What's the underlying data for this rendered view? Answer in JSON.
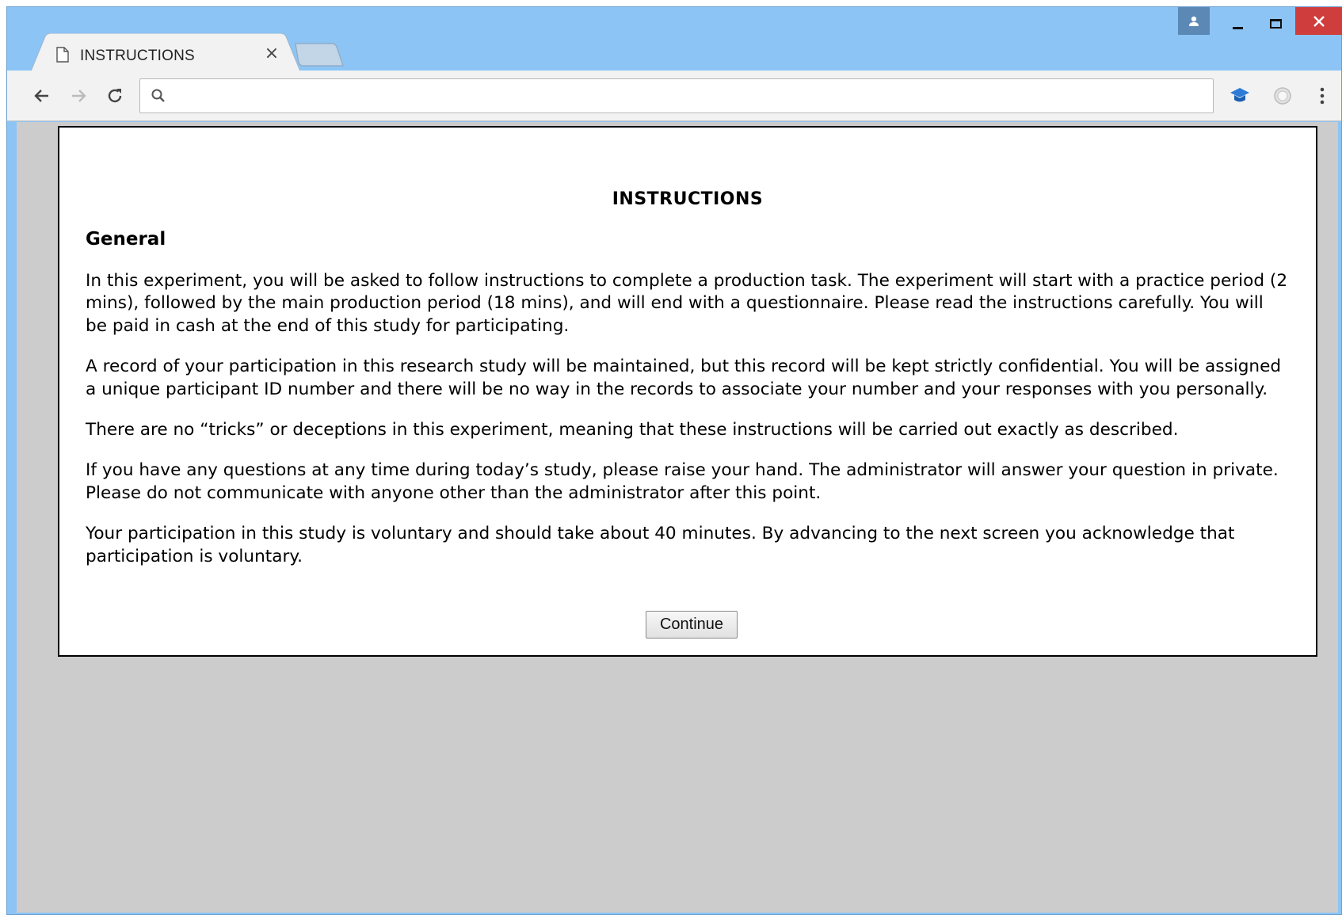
{
  "window": {
    "controls": {
      "profile_icon": "person-icon",
      "minimize_icon": "minimize-icon",
      "maximize_icon": "maximize-icon",
      "close_icon": "close-icon"
    }
  },
  "tab": {
    "title": "INSTRUCTIONS",
    "icon": "document-icon",
    "close_glyph": "×"
  },
  "toolbar": {
    "back_icon": "arrow-left-icon",
    "forward_icon": "arrow-right-icon",
    "reload_icon": "reload-icon",
    "search_icon": "search-icon",
    "address_value": "",
    "extension_icons": [
      "graduation-cap-icon",
      "circle-extension-icon"
    ],
    "menu_icon": "more-vertical-icon"
  },
  "page": {
    "title": "INSTRUCTIONS",
    "section_heading": "General",
    "paragraphs": [
      "In this experiment, you will be asked to follow instructions to complete a production task. The experiment will start with a practice period (2 mins), followed by the main production period (18 mins), and will end with a questionnaire. Please read the instructions carefully. You will be paid in cash at the end of this study for participating.",
      "A record of your participation in this research study will be maintained, but this record will be kept strictly confidential. You will be assigned a unique participant ID number and there will be no way in the records to associate your number and your responses with you personally.",
      "There are no “tricks” or deceptions in this experiment, meaning that these instructions will be carried out exactly as described.",
      "If you have any questions at any time during today’s study, please raise your hand. The administrator will answer your question in private. Please do not communicate with anyone other than the administrator after this point.",
      "Your participation in this study is voluntary and should take about 40 minutes. By advancing to the next screen you acknowledge that participation is voluntary."
    ],
    "continue_label": "Continue"
  },
  "colors": {
    "titlebar": "#8cc4f5",
    "close_button": "#cf3d3d",
    "profile_button": "#5b88b4",
    "viewport_background": "#cccccc",
    "panel_background": "#ffffff"
  }
}
